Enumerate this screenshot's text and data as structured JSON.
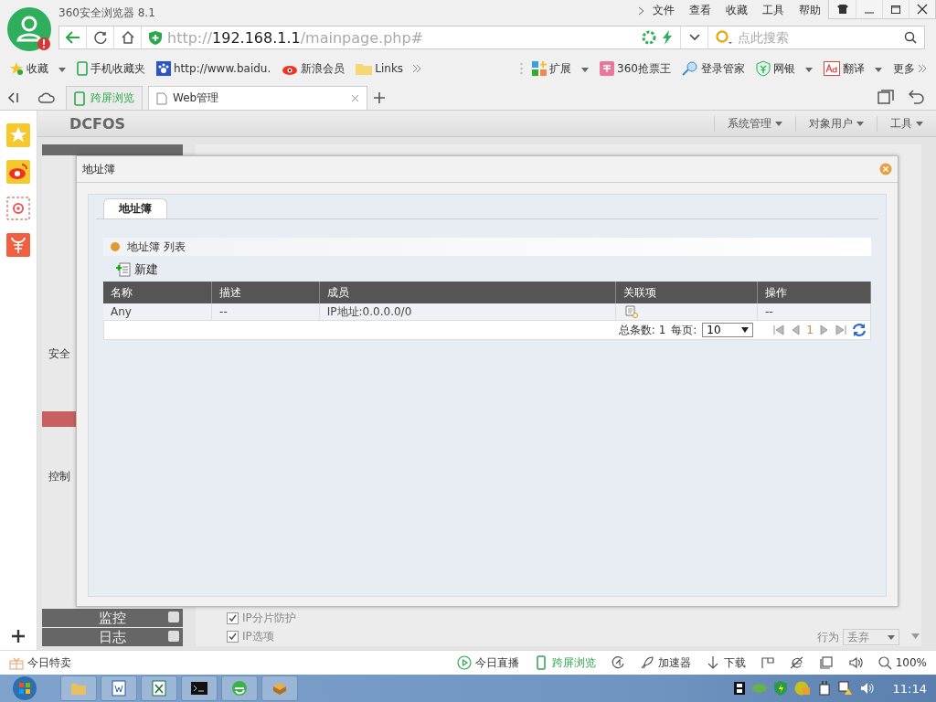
{
  "window": {
    "title": "360安全浏览器 8.1",
    "menu": [
      "文件",
      "查看",
      "收藏",
      "工具",
      "帮助"
    ]
  },
  "address_bar": {
    "scheme": "http://",
    "host": "192.168.1.1",
    "path": "/mainpage.php#"
  },
  "search": {
    "placeholder": "点此搜索"
  },
  "bookmarks": [
    {
      "label": "收藏",
      "kind": "star",
      "dropdown": true
    },
    {
      "label": "手机收藏夹",
      "kind": "phone",
      "dropdown": false
    },
    {
      "label": "http://www.baidu.",
      "kind": "paw",
      "dropdown": false
    },
    {
      "label": "新浪会员",
      "kind": "eye",
      "dropdown": false
    },
    {
      "label": "Links",
      "kind": "folder",
      "dropdown": false
    }
  ],
  "toolbar": [
    {
      "label": "扩展",
      "kind": "grid",
      "dropdown": true
    },
    {
      "label": "360抢票王",
      "kind": "ticket",
      "dropdown": false
    },
    {
      "label": "登录管家",
      "kind": "key",
      "dropdown": false
    },
    {
      "label": "网银",
      "kind": "shield",
      "dropdown": true
    },
    {
      "label": "翻译",
      "kind": "translate",
      "dropdown": true
    },
    {
      "label": "更多",
      "kind": "more"
    }
  ],
  "tabs": [
    {
      "label": "跨屏浏览",
      "kind": "phone",
      "selected": false
    },
    {
      "label": "Web管理",
      "kind": "page",
      "selected": true
    }
  ],
  "page": {
    "brand": "DCFOS",
    "top_menu": [
      "系统管理",
      "对象用户",
      "工具"
    ],
    "nav": [
      {
        "label": "安全",
        "kind": "section"
      },
      {
        "label": "控制",
        "kind": "section"
      },
      {
        "label": "监控",
        "kind": "bar"
      },
      {
        "label": "日志",
        "kind": "bar"
      }
    ],
    "options": [
      {
        "label": "IP分片防护",
        "checked": true
      },
      {
        "label": "IP选项",
        "checked": true
      }
    ],
    "action": {
      "label": "行为",
      "value": "丢弃"
    }
  },
  "dialog": {
    "title": "地址簿",
    "tabs": [
      {
        "label": "地址簿",
        "selected": true
      }
    ],
    "section_title": "地址簿 列表",
    "new_button": "新建",
    "table": {
      "columns": [
        "名称",
        "描述",
        "成员",
        "关联项",
        "操作"
      ],
      "rows": [
        [
          "Any",
          "--",
          "IP地址:0.0.0.0/0",
          "",
          "--"
        ]
      ]
    },
    "pager": {
      "total": "总条数: 1",
      "per_page_label": "每页:",
      "per_page": "10",
      "page": "1"
    }
  },
  "status_bar": {
    "left": "今日特卖",
    "items": [
      {
        "label": "今日直播",
        "kind": "play"
      },
      {
        "label": "跨屏浏览",
        "kind": "phone"
      },
      {
        "kind": "clock"
      },
      {
        "label": "加速器",
        "kind": "rocket"
      },
      {
        "label": "下载",
        "kind": "download"
      },
      {
        "kind": "flag"
      },
      {
        "kind": "ie"
      },
      {
        "kind": "window"
      },
      {
        "kind": "sound"
      },
      {
        "label": "100%",
        "kind": "zoom"
      }
    ]
  },
  "taskbar": {
    "clock": "11:14"
  }
}
